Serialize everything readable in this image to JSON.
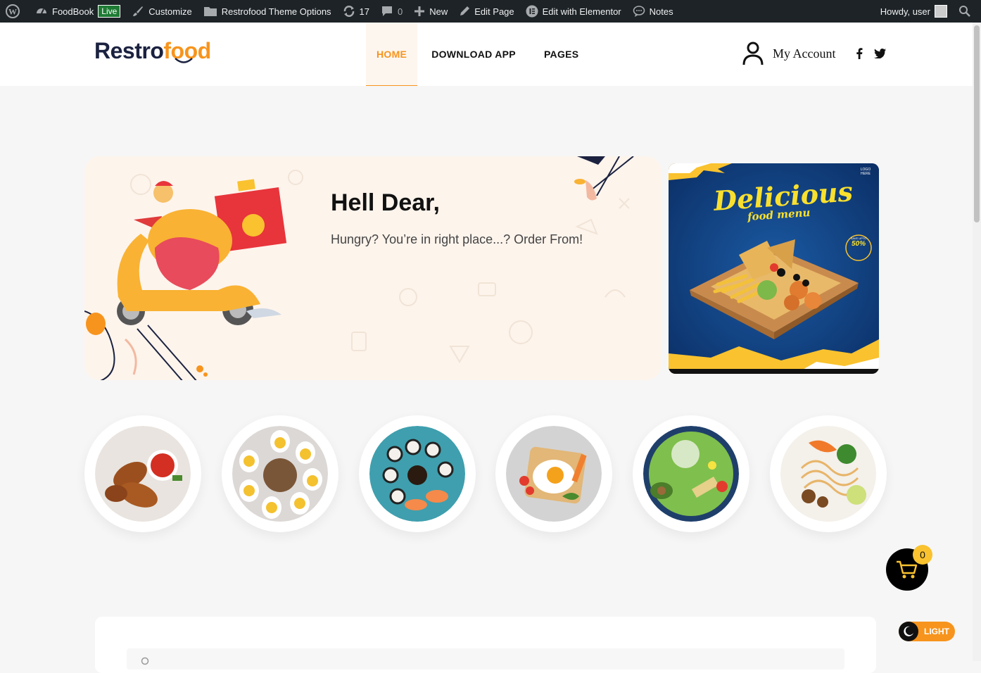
{
  "adminbar": {
    "site": "FoodBook",
    "live": "Live",
    "customize": "Customize",
    "theme_options": "Restrofood Theme Options",
    "updates": "17",
    "comments": "0",
    "new": "New",
    "edit_page": "Edit Page",
    "elementor": "Edit with Elementor",
    "notes": "Notes",
    "howdy": "Howdy, user"
  },
  "header": {
    "logo_part1": "Restro",
    "logo_part2": "food",
    "nav": [
      "HOME",
      "DOWNLOAD APP",
      "PAGES"
    ],
    "account": "My Account"
  },
  "hero": {
    "title": "Hell Dear,",
    "subtitle": "Hungry? You’re in right place...? Order From!"
  },
  "banner": {
    "title": "Delicious",
    "subtitle": "food menu",
    "badge_top": "SAVE UPTO",
    "badge_value": "50%",
    "logo_text": "LOGO HERE"
  },
  "categories": [
    "chicken-wings",
    "eggs-salad",
    "sushi",
    "fried-egg-toast",
    "guacamole-platter",
    "noodle-bowl"
  ],
  "cart": {
    "count": "0"
  },
  "theme_toggle": {
    "label": "LIGHT"
  },
  "colors": {
    "accent": "#f7941d",
    "dark": "#1b2240",
    "adminbar": "#1d2327"
  }
}
